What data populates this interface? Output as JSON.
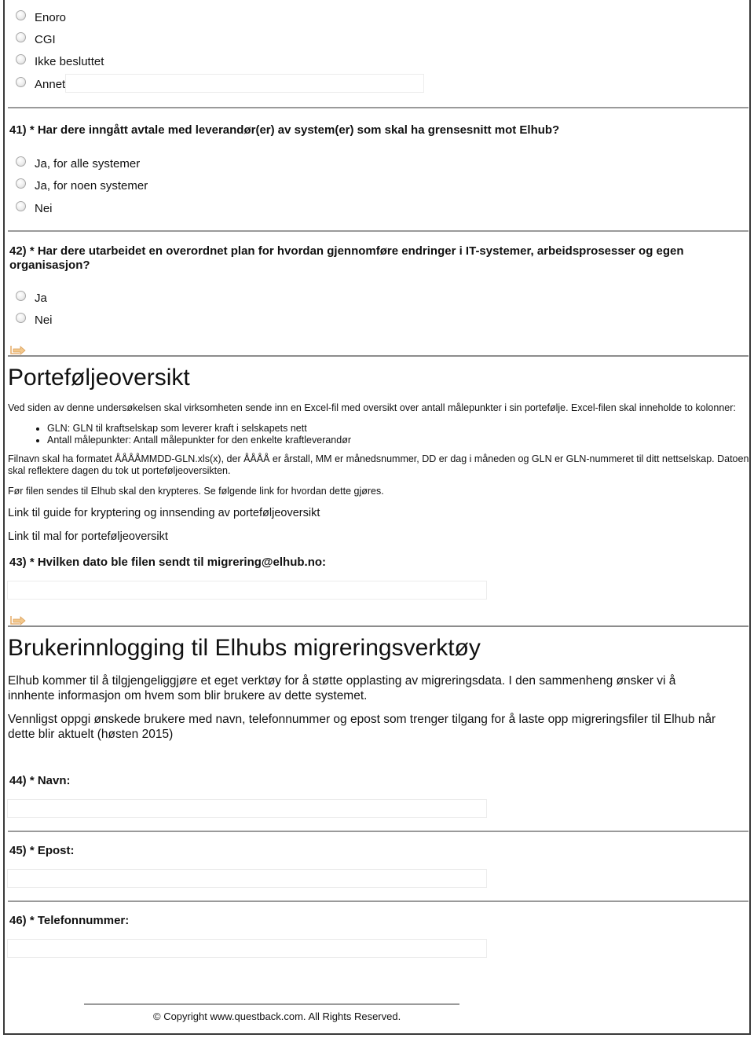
{
  "q40_continued": {
    "options": [
      "Enoro",
      "CGI",
      "Ikke besluttet",
      "Annet"
    ],
    "other_value": ""
  },
  "q41": {
    "title": "41) * Har dere inngått avtale med leverandør(er) av system(er) som skal ha grensesnitt mot Elhub?",
    "options": [
      "Ja, for alle systemer",
      "Ja, for noen systemer",
      "Nei"
    ]
  },
  "q42": {
    "title_line1": "42) * Har dere utarbeidet en overordnet plan for hvordan gjennomføre endringer i IT-systemer, arbeidsprosesser og egen",
    "title_line2": "organisasjon?",
    "options": [
      "Ja",
      "Nei"
    ]
  },
  "portfolio": {
    "heading": "Porteføljeoversikt",
    "intro": "Ved siden av denne undersøkelsen skal virksomheten sende inn en Excel-fil med oversikt over antall målepunkter i sin portefølje. Excel-filen skal inneholde to kolonner:",
    "bullets": [
      "GLN: GLN til kraftselskap som leverer kraft i selskapets nett",
      "Antall målepunkter: Antall målepunkter for den enkelte kraftleverandør"
    ],
    "filename_line1": "Filnavn skal ha formatet ÅÅÅÅMMDD-GLN.xls(x), der ÅÅÅÅ er årstall, MM er månedsnummer, DD er dag i måneden og GLN er GLN-nummeret til ditt nettselskap. Datoen",
    "filename_line2": "skal reflektere dagen du tok ut porteføljeoversikten.",
    "encrypt_note": "Før filen sendes til Elhub skal den krypteres. Se følgende link for hvordan dette gjøres.",
    "link_guide": "Link til guide for kryptering og innsending av porteføljeoversikt",
    "link_template": "Link til mal for porteføljeoversikt"
  },
  "q43": {
    "title": "43) * Hvilken dato ble filen sendt til migrering@elhub.no:",
    "value": ""
  },
  "login": {
    "heading": "Brukerinnlogging til Elhubs migreringsverktøy",
    "para1_line1": "Elhub kommer til å tilgjengeliggjøre et eget verktøy for å støtte opplasting av migreringsdata. I den sammenheng ønsker vi å",
    "para1_line2": "innhente informasjon om hvem som blir brukere av dette systemet.",
    "para2_line1": "Vennligst oppgi ønskede brukere med navn, telefonnummer og epost som trenger tilgang for å laste opp migreringsfiler til Elhub når",
    "para2_line2": "dette blir aktuelt (høsten 2015)"
  },
  "q44": {
    "title": "44) * Navn:",
    "value": ""
  },
  "q45": {
    "title": "45) * Epost:",
    "value": ""
  },
  "q46": {
    "title": "46) * Telefonnummer:",
    "value": ""
  },
  "footer": {
    "copyright": "© Copyright www.questback.com. All Rights Reserved."
  },
  "icons": {
    "next_page": "page-arrow-icon",
    "radio": "radio-unchecked"
  },
  "colors": {
    "divider": "#9a9a9a",
    "frame": "#3a3a3a",
    "next_icon": "#e8b070"
  }
}
